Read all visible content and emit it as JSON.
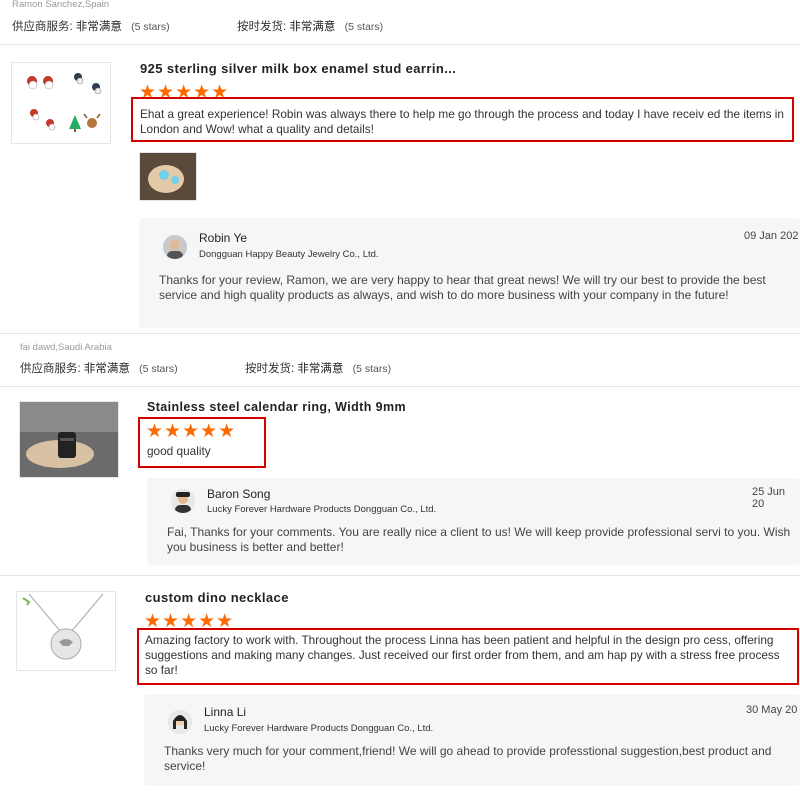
{
  "colors": {
    "star": "#ff6a00",
    "highlight_box": "#d40000",
    "reply_bg": "#f5f6f7"
  },
  "reviews": [
    {
      "buyer": "Ramon Sanchez,Spain",
      "supplier_service_label": "供应商服务:",
      "supplier_service_value": "非常满意",
      "supplier_service_stars": "(5 stars)",
      "shipping_label": "按时发货:",
      "shipping_value": "非常满意",
      "shipping_stars": "(5 stars)",
      "product_title": "925 sterling silver milk box enamel stud earrin...",
      "stars": "★★★★★",
      "text": "Ehat a great experience! Robin was always there to help me go through the process and today I have receiv ed the items in London and Wow! what a quality and details!",
      "reply": {
        "name": "Robin Ye",
        "company": "Dongguan Happy Beauty Jewelry Co., Ltd.",
        "date": "09 Jan 202",
        "text": "Thanks for your review, Ramon, we are very happy to hear that great news! We will try our best to provide the best service and high quality products as always, and wish to do more business with your company in the future!"
      }
    },
    {
      "buyer": "fai dawd,Saudi Arabia",
      "supplier_service_label": "供应商服务:",
      "supplier_service_value": "非常满意",
      "supplier_service_stars": "(5 stars)",
      "shipping_label": "按时发货:",
      "shipping_value": "非常满意",
      "shipping_stars": "(5 stars)",
      "product_title": "Stainless steel calendar ring, Width 9mm",
      "stars": "★★★★★",
      "text": "good quality",
      "reply": {
        "name": "Baron Song",
        "company": "Lucky Forever Hardware Products Dongguan Co., Ltd.",
        "date": "25 Jun 20",
        "text": "Fai, Thanks for your comments. You are really nice a client to us!  We will keep provide professional servi to you. Wish you business is better and better!"
      }
    },
    {
      "product_title": "custom dino necklace",
      "stars": "★★★★★",
      "text": "Amazing factory to work with. Throughout the process Linna has been patient and helpful in the design pro cess, offering suggestions and making many changes. Just received our first order from them, and am hap py with a stress free process so far!",
      "reply": {
        "name": "Linna Li",
        "company": "Lucky Forever Hardware Products Dongguan Co., Ltd.",
        "date": "30 May 20",
        "text": "Thanks very much for your comment,friend! We will go ahead to provide professtional suggestion,best product and service!"
      }
    }
  ]
}
